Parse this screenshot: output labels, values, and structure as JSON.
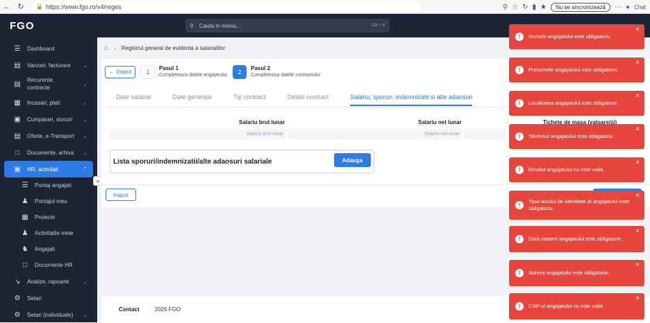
{
  "browser": {
    "url": "https://www.fgo.ro/v4/reges",
    "sync_label": "Nu se sincronizează",
    "chat_label": "Chat"
  },
  "app": {
    "logo": "FGO",
    "search_placeholder": "Cauta in meniu...",
    "search_shortcut": "Ctrl + K"
  },
  "sidebar": {
    "items": [
      {
        "label": "Dashboard",
        "icon": "dashboard-icon"
      },
      {
        "label": "Vanzari, facturare",
        "icon": "invoice-icon"
      },
      {
        "label": "Recurente, contracte",
        "icon": "recurring-icon"
      },
      {
        "label": "Incasari, plati",
        "icon": "payments-icon"
      },
      {
        "label": "Cumparari, stocuri",
        "icon": "cart-icon"
      },
      {
        "label": "Oferte, e-Transport",
        "icon": "offers-icon"
      },
      {
        "label": "Documente, arhiva",
        "icon": "archive-icon"
      },
      {
        "label": "HR, activitati",
        "icon": "hr-icon"
      },
      {
        "label": "Pontaj angajati",
        "icon": "timesheet-icon"
      },
      {
        "label": "Pontajul meu",
        "icon": "user-time-icon"
      },
      {
        "label": "Proiecte",
        "icon": "projects-icon"
      },
      {
        "label": "Activitatile mele",
        "icon": "user-check-icon"
      },
      {
        "label": "Angajati",
        "icon": "employees-icon"
      },
      {
        "label": "Documente HR",
        "icon": "document-icon"
      },
      {
        "label": "Analize, rapoarte",
        "icon": "chart-icon"
      },
      {
        "label": "Setari",
        "icon": "settings-icon"
      },
      {
        "label": "Setari (individuale)",
        "icon": "settings-user-icon"
      }
    ]
  },
  "breadcrumb": {
    "title": "Registrul general de evidenta a salariatilor"
  },
  "stepper": {
    "back_label": "Inapoi",
    "steps": [
      {
        "num": "1",
        "title": "Pasul 1",
        "subtitle": "Completeaza datele angajatului"
      },
      {
        "num": "2",
        "title": "Pasul 2",
        "subtitle": "Completeaza datele contractului"
      }
    ]
  },
  "tabs": [
    "Date salariat",
    "Date generale",
    "Tip contract",
    "Detalii contract",
    "Salariu, sporuri, indemnizatii si alte adaosuri"
  ],
  "salary": {
    "brut_label": "Salariu brut lunar",
    "brut_placeholder": "Salariu brut lunar",
    "net_label": "Salariu net lunar",
    "net_placeholder": "Salariu net lunar",
    "tichete_label": "Tichete de masa (valoare/zi)"
  },
  "lista": {
    "title": "Lista sporuri/indemnizatii/alte adaosuri salariale",
    "add_label": "Adauga"
  },
  "bottom": {
    "back_label": "Inapoi"
  },
  "footer": {
    "contact": "Contact",
    "copyright": "2026 FGO"
  },
  "toasts": [
    "Numele angajatului este obligatoriu.",
    "Prenumele angajatului este obligatoriu.",
    "Localitatea angajatului este obligatorie.",
    "Telefonul angajatului este obligatoriu.",
    "Emailul angajatului nu este valid.",
    "Tipul actului de identitate al angajatului este obligatoriu.",
    "Data nasterii angajatului este obligatorie.",
    "Adresa angajatului este obligatorie.",
    "CNP-ul angajatului nu este valid."
  ],
  "colors": {
    "accent": "#2d7be5",
    "sidebar": "#1d2433",
    "toast": "#e8453c"
  }
}
